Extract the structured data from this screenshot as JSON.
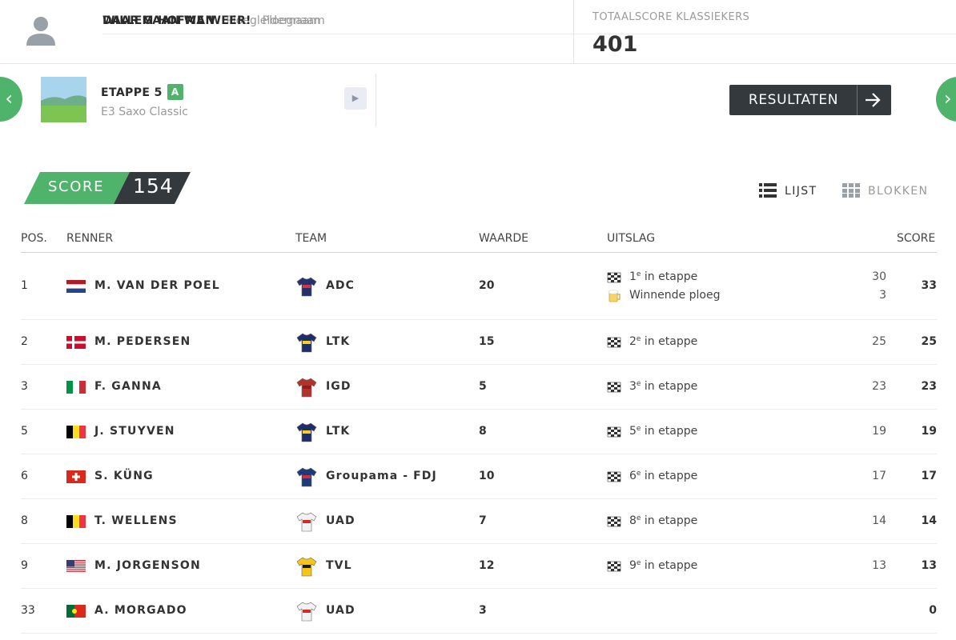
{
  "manager": {
    "name": "WILLEM HOFMAN",
    "name_label": "Ploegleidernaam",
    "team": "DAAR GAAN WE WEER!",
    "team_label": "Ploegnaam"
  },
  "total": {
    "label": "TOTAALSCORE KLASSIEKERS",
    "value": "401"
  },
  "stage": {
    "title": "ETAPPE 5",
    "badge": "A",
    "subtitle": "E3 Saxo Classic"
  },
  "results_button": "RESULTATEN",
  "score": {
    "label": "SCORE",
    "value": "154"
  },
  "views": {
    "list": "LIJST",
    "blocks": "BLOKKEN"
  },
  "columns": [
    "POS.",
    "RENNER",
    "TEAM",
    "WAARDE",
    "UITSLAG",
    "SCORE"
  ],
  "icons": {
    "finish": "checkered-flag-icon",
    "team_win": "beer-mug-icon"
  },
  "colors": {
    "accent_green": "#4fb36b",
    "dark": "#33393d"
  },
  "rows": [
    {
      "pos": "1",
      "flag": "nl",
      "rider": "M. VAN DER POEL",
      "jersey": "adc",
      "team": "ADC",
      "value": "20",
      "results": [
        {
          "icon": "finish",
          "rank": "1",
          "sup": "e",
          "text": " in etappe",
          "points": "30"
        },
        {
          "icon": "team",
          "text": "Winnende ploeg",
          "points": "3"
        }
      ],
      "score": "33"
    },
    {
      "pos": "2",
      "flag": "dk",
      "rider": "M. PEDERSEN",
      "jersey": "ltk",
      "team": "LTK",
      "value": "15",
      "results": [
        {
          "icon": "finish",
          "rank": "2",
          "sup": "e",
          "text": " in etappe",
          "points": "25"
        }
      ],
      "score": "25"
    },
    {
      "pos": "3",
      "flag": "it",
      "rider": "F. GANNA",
      "jersey": "igd",
      "team": "IGD",
      "value": "5",
      "results": [
        {
          "icon": "finish",
          "rank": "3",
          "sup": "e",
          "text": " in etappe",
          "points": "23"
        }
      ],
      "score": "23"
    },
    {
      "pos": "5",
      "flag": "be",
      "rider": "J. STUYVEN",
      "jersey": "ltk",
      "team": "LTK",
      "value": "8",
      "results": [
        {
          "icon": "finish",
          "rank": "5",
          "sup": "e",
          "text": " in etappe",
          "points": "19"
        }
      ],
      "score": "19"
    },
    {
      "pos": "6",
      "flag": "ch",
      "rider": "S. KÜNG",
      "jersey": "fdj",
      "team": "Groupama - FDJ",
      "value": "10",
      "results": [
        {
          "icon": "finish",
          "rank": "6",
          "sup": "e",
          "text": " in etappe",
          "points": "17"
        }
      ],
      "score": "17"
    },
    {
      "pos": "8",
      "flag": "be",
      "rider": "T. WELLENS",
      "jersey": "uad",
      "team": "UAD",
      "value": "7",
      "results": [
        {
          "icon": "finish",
          "rank": "8",
          "sup": "e",
          "text": " in etappe",
          "points": "14"
        }
      ],
      "score": "14"
    },
    {
      "pos": "9",
      "flag": "us",
      "rider": "M. JORGENSON",
      "jersey": "tvl",
      "team": "TVL",
      "value": "12",
      "results": [
        {
          "icon": "finish",
          "rank": "9",
          "sup": "e",
          "text": " in etappe",
          "points": "13"
        }
      ],
      "score": "13"
    },
    {
      "pos": "33",
      "flag": "pt",
      "rider": "A. MORGADO",
      "jersey": "uad",
      "team": "UAD",
      "value": "3",
      "results": [],
      "score": "0"
    }
  ]
}
